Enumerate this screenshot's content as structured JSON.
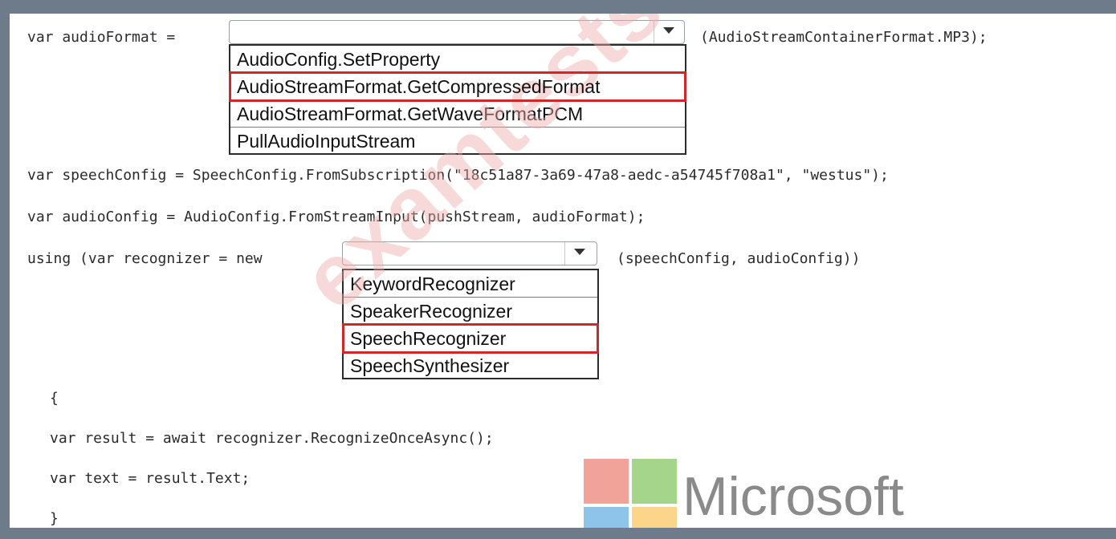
{
  "code": {
    "line_audio_format_prefix": "var audioFormat =",
    "line_audio_format_suffix": "(AudioStreamContainerFormat.MP3);",
    "line_speech_config": "var speechConfig = SpeechConfig.FromSubscription(\"18c51a87-3a69-47a8-aedc-a54745f708a1\", \"westus\");",
    "line_audio_config": "var audioConfig = AudioConfig.FromStreamInput(pushStream, audioFormat);",
    "line_using_prefix": "using (var recognizer = new",
    "line_using_suffix": "(speechConfig, audioConfig))",
    "line_open_brace": "{",
    "line_result": "var result = await recognizer.RecognizeOnceAsync();",
    "line_text": "var text = result.Text;",
    "line_close_brace": "}"
  },
  "dropdown_audio_format": {
    "options": [
      "AudioConfig.SetProperty",
      "AudioStreamFormat.GetCompressedFormat",
      "AudioStreamFormat.GetWaveFormatPCM",
      "PullAudioInputStream"
    ],
    "highlighted": "AudioStreamFormat.GetCompressedFormat"
  },
  "dropdown_recognizer": {
    "options": [
      "KeywordRecognizer",
      "SpeakerRecognizer",
      "SpeechRecognizer",
      "SpeechSynthesizer"
    ],
    "highlighted": "SpeechRecognizer"
  },
  "watermark": "examtests.com",
  "logo": {
    "text": "Microsoft",
    "colors": [
      "#f1a39a",
      "#a5d48b",
      "#8ec3ea",
      "#fcd58a"
    ]
  },
  "colors": {
    "highlight_border": "#d02828",
    "background_frame": "#6d7b8a"
  }
}
